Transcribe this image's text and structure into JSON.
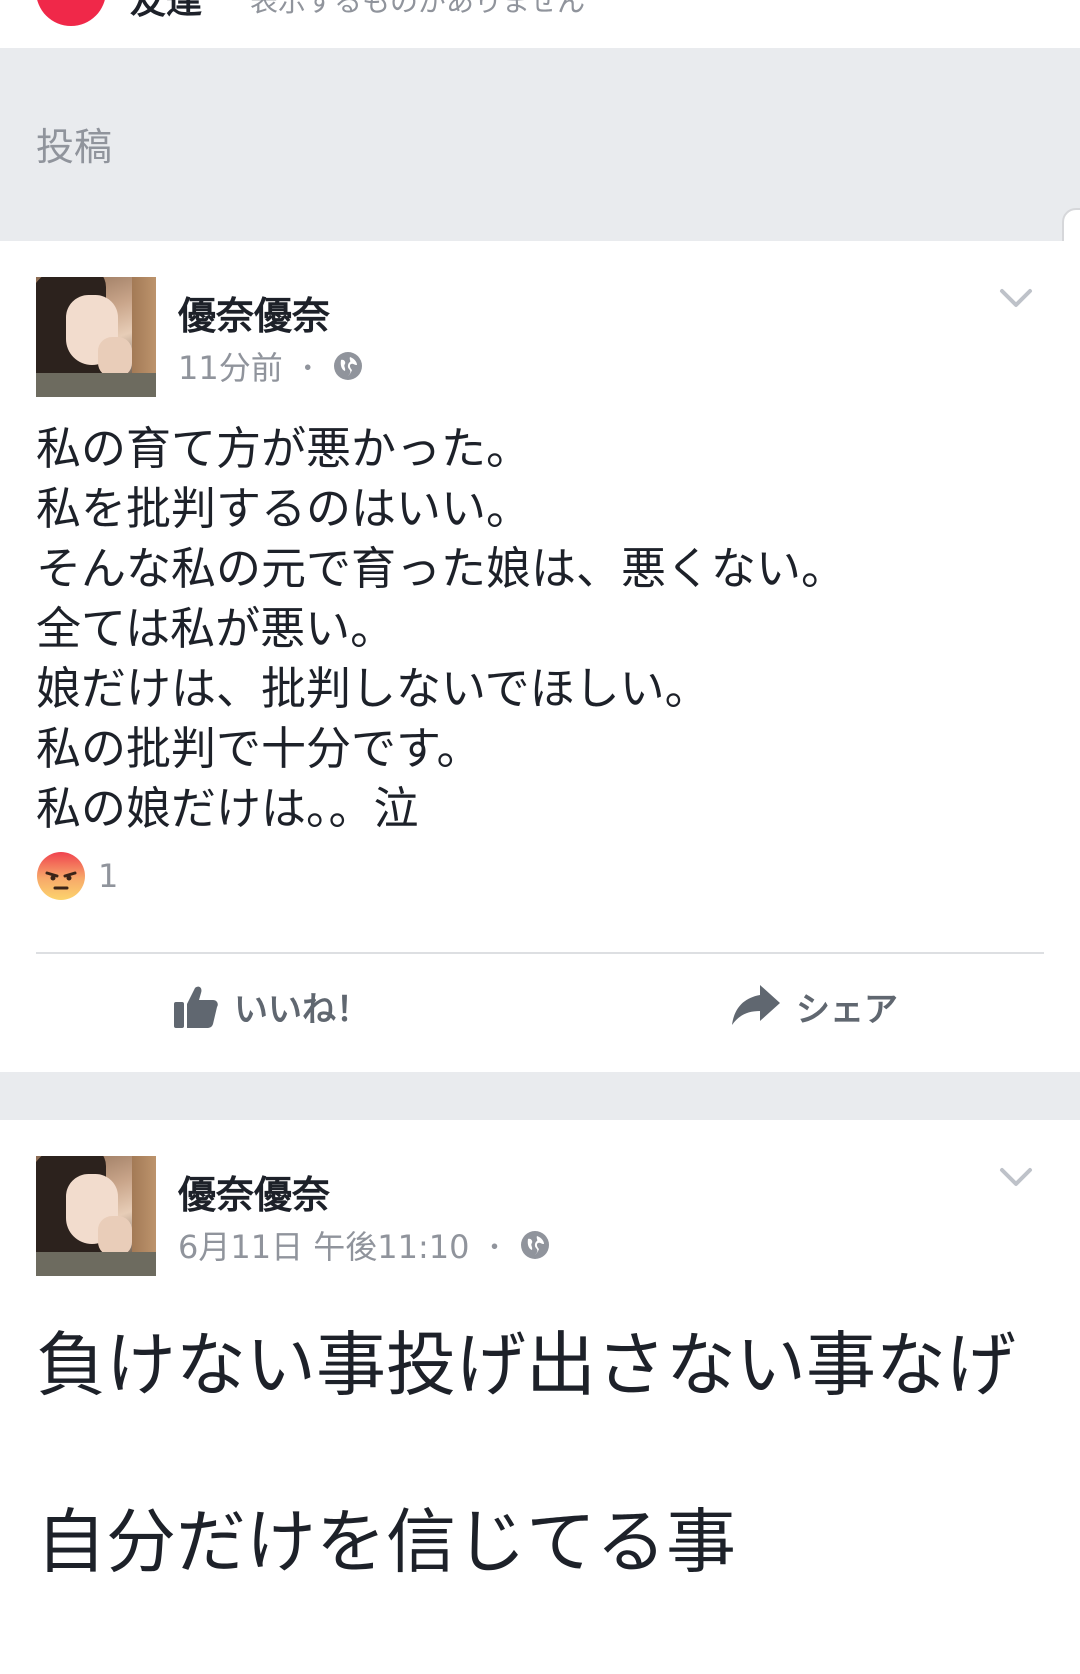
{
  "header": {
    "friends_title": "友達",
    "friends_subtitle": "表示するものがありません",
    "section_label": "投稿"
  },
  "posts": [
    {
      "author": "優奈優奈",
      "timestamp": "11分前",
      "separator": "・",
      "audience_icon": "globe-icon",
      "lines": [
        "私の育て方が悪かった。",
        "私を批判するのはいい。",
        "そんな私の元で育った娘は、悪くない。",
        "全ては私が悪い。",
        "娘だけは、批判しないでほしい。",
        "私の批判で十分です。",
        "私の娘だけは。。泣"
      ],
      "reaction": {
        "icon": "angry-icon",
        "count": "1"
      },
      "actions": {
        "like_label": "いいね！",
        "share_label": "シェア"
      }
    },
    {
      "author": "優奈優奈",
      "timestamp": "6月11日 午後11:10",
      "separator": "・",
      "audience_icon": "globe-icon",
      "lines": [
        "負けない事投げ出さない事なげ",
        "自分だけを信じてる事"
      ]
    }
  ],
  "colors": {
    "background": "#e9ebee",
    "text": "#1d2129",
    "meta": "#90949c",
    "action": "#606770",
    "accent": "#f02849"
  }
}
